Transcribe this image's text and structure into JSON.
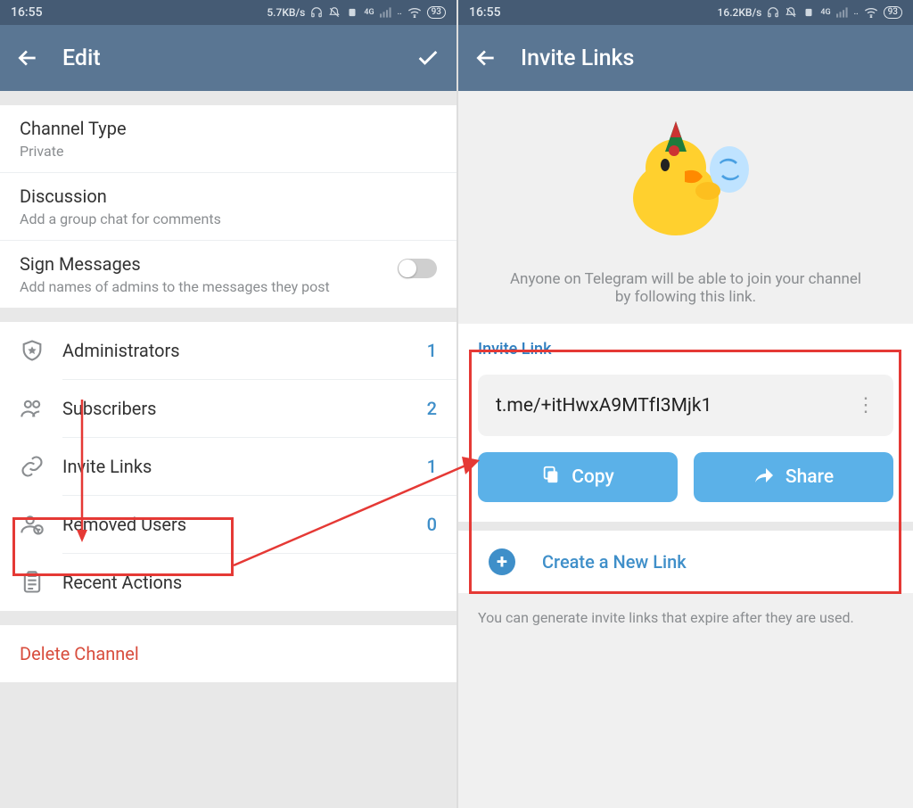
{
  "status": {
    "time": "16:55",
    "net_left": "5.7KB/s",
    "net_right": "16.2KB/s",
    "signal_label": "4G",
    "battery": "93"
  },
  "left": {
    "title": "Edit",
    "channel_type": {
      "label": "Channel Type",
      "value": "Private"
    },
    "discussion": {
      "label": "Discussion",
      "sub": "Add a group chat for comments"
    },
    "sign_messages": {
      "label": "Sign Messages",
      "sub": "Add names of admins to the messages they post"
    },
    "rows": {
      "administrators": {
        "label": "Administrators",
        "count": "1"
      },
      "subscribers": {
        "label": "Subscribers",
        "count": "2"
      },
      "invite_links": {
        "label": "Invite Links",
        "count": "1"
      },
      "removed_users": {
        "label": "Removed Users",
        "count": "0"
      },
      "recent_actions": {
        "label": "Recent Actions",
        "count": ""
      }
    },
    "delete": "Delete Channel"
  },
  "right": {
    "title": "Invite Links",
    "hero_text": "Anyone on Telegram will be able to join your channel by following this link.",
    "card_title": "Invite Link",
    "link": "t.me/+itHwxA9MTfI3Mjk1",
    "copy_label": "Copy",
    "share_label": "Share",
    "create_label": "Create a New Link",
    "footer": "You can generate invite links that expire after they are used."
  }
}
